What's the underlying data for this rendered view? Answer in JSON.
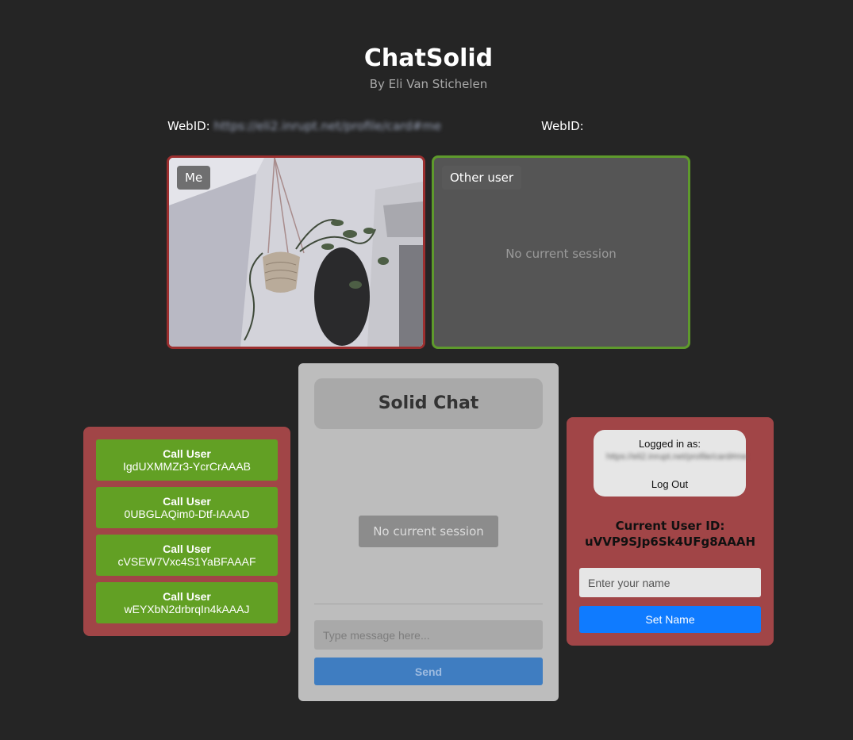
{
  "header": {
    "title": "ChatSolid",
    "subtitle": "By Eli Van Stichelen"
  },
  "webids": {
    "left_label": "WebID:",
    "left_value": "https://eli2.inrupt.net/profile/card#me",
    "right_label": "WebID:"
  },
  "videos": {
    "me_tag": "Me",
    "other_tag": "Other user",
    "other_status": "No current session"
  },
  "call_list": [
    {
      "label": "Call User",
      "id": "IgdUXMMZr3-YcrCrAAAB"
    },
    {
      "label": "Call User",
      "id": "0UBGLAQim0-Dtf-IAAAD"
    },
    {
      "label": "Call User",
      "id": "cVSEW7Vxc4S1YaBFAAAF"
    },
    {
      "label": "Call User",
      "id": "wEYXbN2drbrqIn4kAAAJ"
    }
  ],
  "chat": {
    "title": "Solid Chat",
    "status": "No current session",
    "input_placeholder": "Type message here...",
    "send_label": "Send"
  },
  "profile": {
    "logged_in_label": "Logged in as:",
    "logged_in_webid": "https://eli2.inrupt.net/profile/card#me",
    "logout_label": "Log Out",
    "current_user_label": "Current User ID:",
    "current_user_id": "uVVP9SJp6Sk4UFg8AAAH",
    "name_placeholder": "Enter your name",
    "set_name_label": "Set Name"
  },
  "colors": {
    "background": "#252525",
    "panel_red": "#a14547",
    "call_green": "#62a024",
    "me_border": "#9c2f2f",
    "other_border": "#5e9a2c",
    "send_blue": "#3f7dc1",
    "set_name_blue": "#0f7bff"
  }
}
